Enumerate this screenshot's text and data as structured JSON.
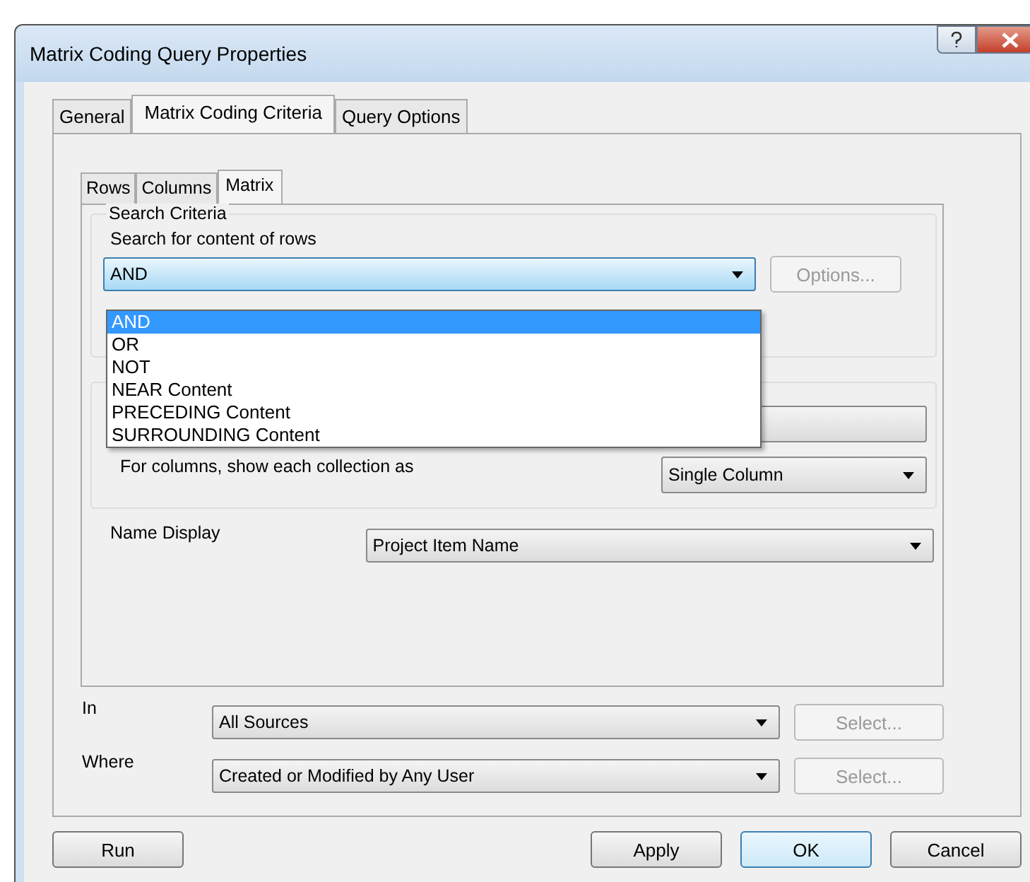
{
  "window": {
    "title": "Matrix Coding Query Properties"
  },
  "tabs": [
    {
      "label": "General",
      "selected": false
    },
    {
      "label": "Matrix Coding Criteria",
      "selected": true
    },
    {
      "label": "Query Options",
      "selected": false
    }
  ],
  "subtabs": [
    {
      "label": "Rows",
      "selected": false
    },
    {
      "label": "Columns",
      "selected": false
    },
    {
      "label": "Matrix",
      "selected": true
    }
  ],
  "search_criteria": {
    "title": "Search Criteria",
    "label": "Search for content of rows",
    "value": "AND",
    "options_button": "Options...",
    "options_disabled": true,
    "dropdown": [
      {
        "label": "AND",
        "selected": true
      },
      {
        "label": "OR",
        "selected": false
      },
      {
        "label": "NOT",
        "selected": false
      },
      {
        "label": "NEAR Content",
        "selected": false
      },
      {
        "label": "PRECEDING Content",
        "selected": false
      },
      {
        "label": "SURROUNDING Content",
        "selected": false
      }
    ]
  },
  "columns_label": "For columns, show each collection as",
  "columns_value": "Single Column",
  "name_display": {
    "label": "Name Display",
    "value": "Project Item Name"
  },
  "scope": [
    {
      "label": "In",
      "value": "All Sources",
      "button": "Select...",
      "disabled": true
    },
    {
      "label": "Where",
      "value": "Created or Modified by Any User",
      "button": "Select...",
      "disabled": true
    }
  ],
  "buttons": [
    {
      "label": "Run",
      "default": false
    },
    {
      "label": "Apply",
      "default": false
    },
    {
      "label": "OK",
      "default": true
    },
    {
      "label": "Cancel",
      "default": false
    }
  ]
}
